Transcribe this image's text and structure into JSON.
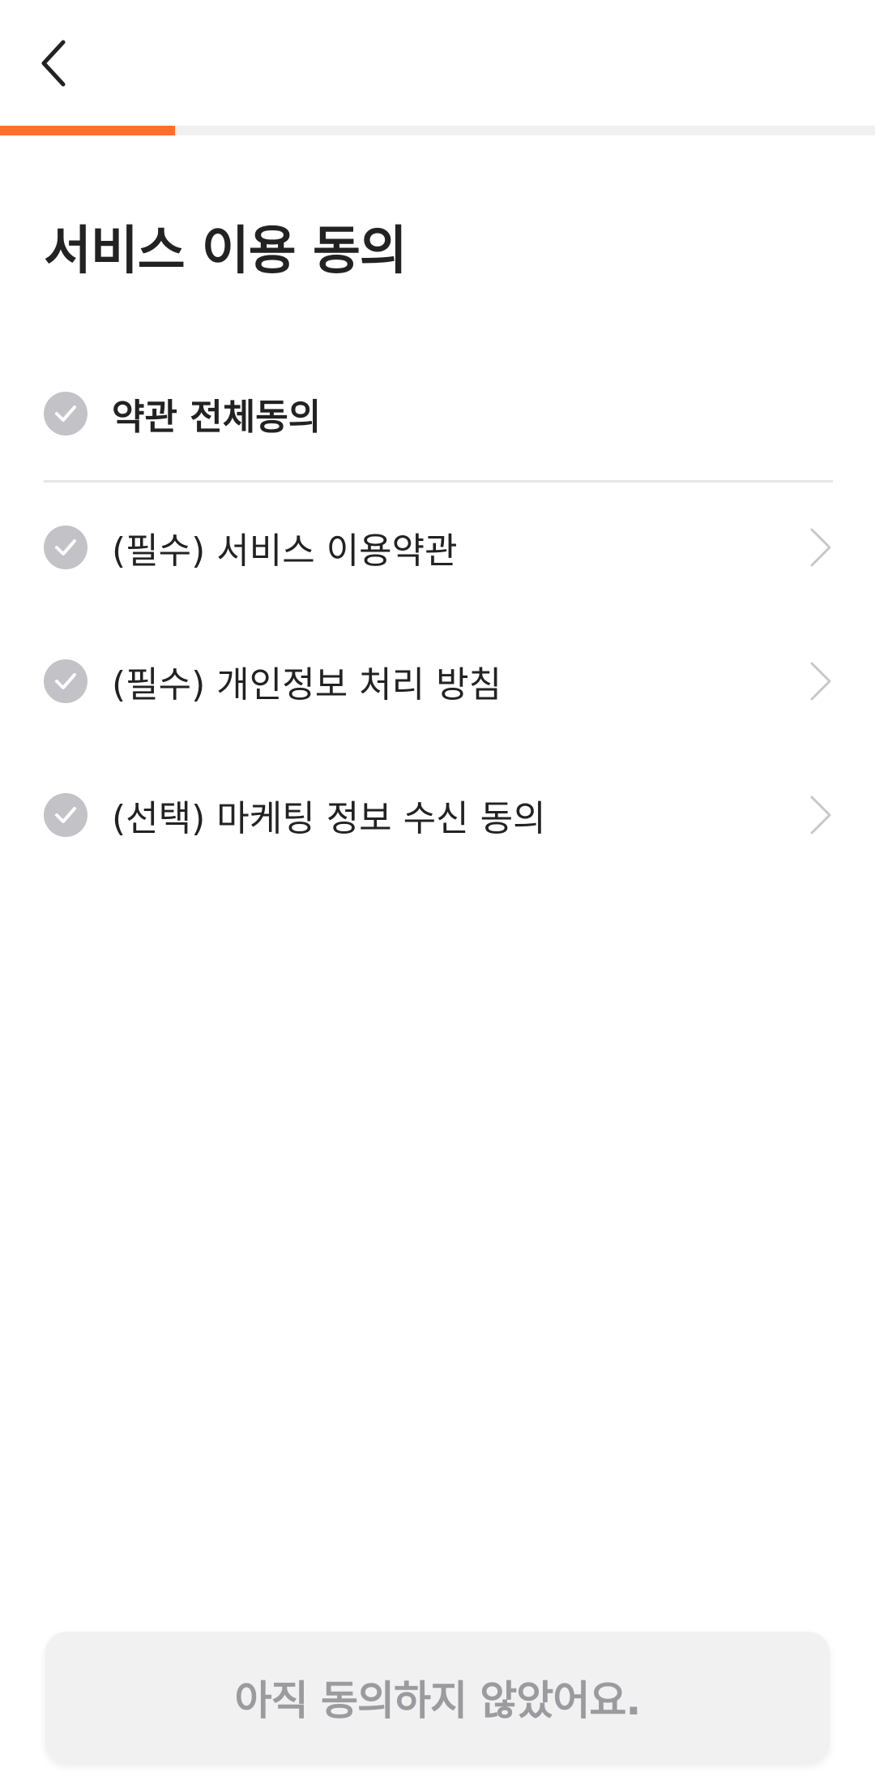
{
  "header": {
    "back_icon": "chevron-left-icon"
  },
  "progress": {
    "value": 0.2,
    "accent_color": "#ff6f2c",
    "track_color": "#f1f1f1"
  },
  "title": "서비스 이용 동의",
  "agree_all": {
    "label": "약관 전체동의",
    "checked": false
  },
  "terms": [
    {
      "label": "(필수) 서비스 이용약관",
      "checked": false
    },
    {
      "label": "(필수) 개인정보 처리 방침",
      "checked": false
    },
    {
      "label": "(선택) 마케팅 정보 수신 동의",
      "checked": false
    }
  ],
  "submit_button": {
    "label": "아직 동의하지 않았어요.",
    "enabled": false
  }
}
